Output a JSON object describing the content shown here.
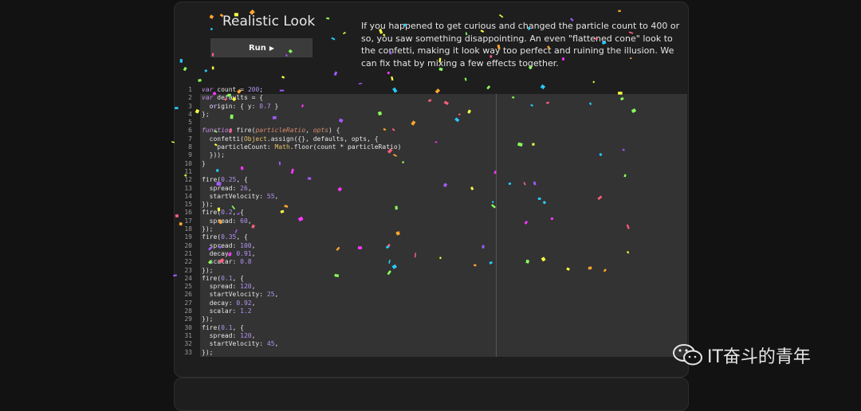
{
  "panel": {
    "title": "Realistic Look",
    "run_label": "Run",
    "description": "If you happened to get curious and changed the particle count to 400 or so, you saw something disappointing. An even \"flattened cone\" look to the confetti, making it look way too perfect and ruining the illusion. We can fix that by mixing a few effects together."
  },
  "code_lines": [
    "var count = 200;",
    "var defaults = {",
    "  origin: { y: 0.7 }",
    "};",
    "",
    "function fire(particleRatio, opts) {",
    "  confetti(Object.assign({}, defaults, opts, {",
    "    particleCount: Math.floor(count * particleRatio)",
    "  }));",
    "}",
    "",
    "fire(0.25, {",
    "  spread: 26,",
    "  startVelocity: 55,",
    "});",
    "fire(0.2, {",
    "  spread: 60,",
    "});",
    "fire(0.35, {",
    "  spread: 100,",
    "  decay: 0.91,",
    "  scalar: 0.8",
    "});",
    "fire(0.1, {",
    "  spread: 120,",
    "  startVelocity: 25,",
    "  decay: 0.92,",
    "  scalar: 1.2",
    "});",
    "fire(0.1, {",
    "  spread: 120,",
    "  startVelocity: 45,",
    "});"
  ],
  "watermark": {
    "text": "IT奋斗的青年",
    "icon": "wechat-icon"
  },
  "colors": {
    "confetti": [
      "#26ccff",
      "#a25afd",
      "#ff5e7e",
      "#88ff5a",
      "#fcff42",
      "#ffa62d",
      "#ff36ff"
    ]
  }
}
